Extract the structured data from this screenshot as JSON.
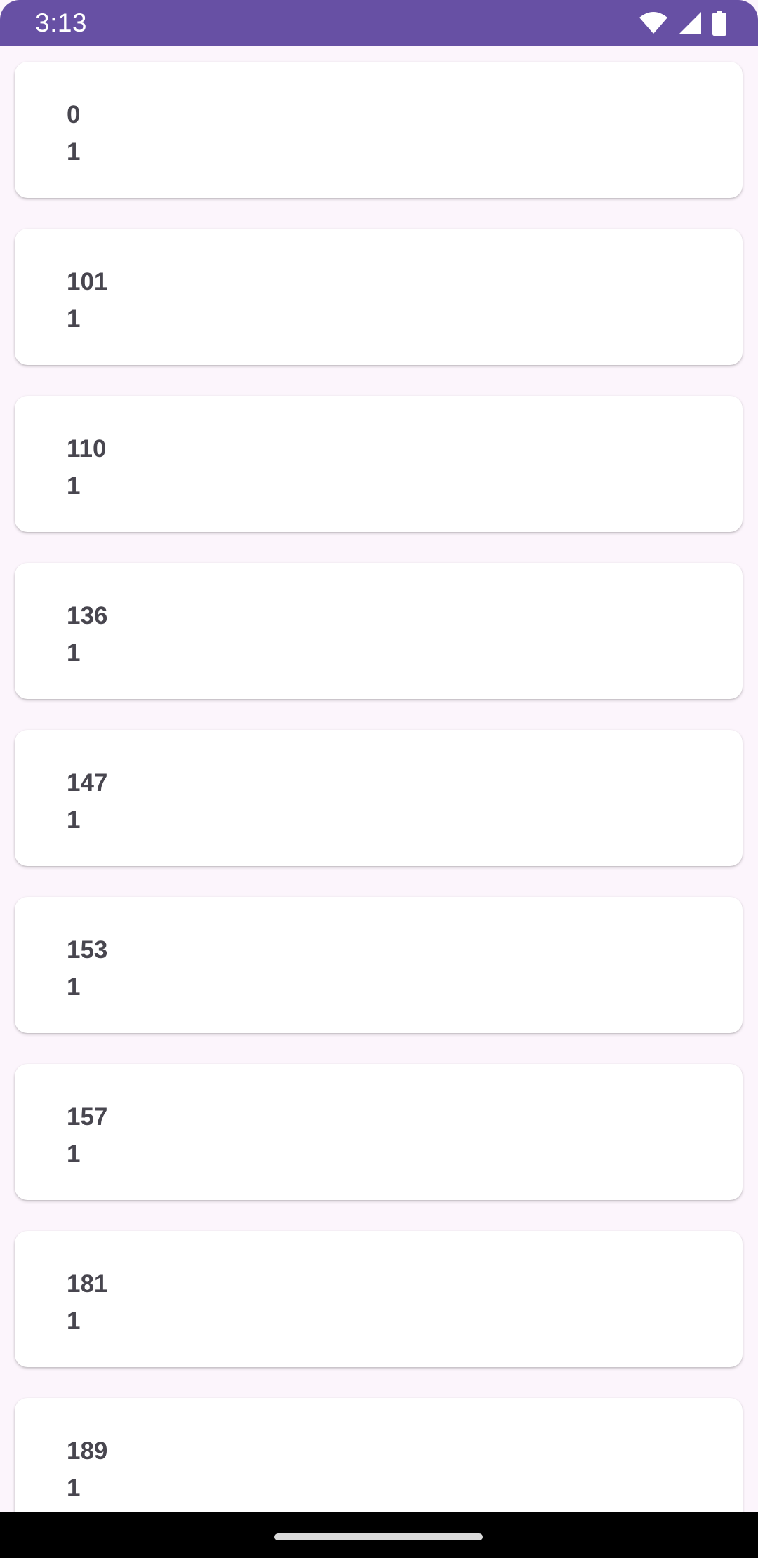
{
  "status_bar": {
    "time": "3:13",
    "background": "#6750A4",
    "icons": [
      "wifi-icon",
      "cellular-signal-icon",
      "battery-icon"
    ]
  },
  "list": {
    "items": [
      {
        "title": "0",
        "subtitle": "1"
      },
      {
        "title": "101",
        "subtitle": "1"
      },
      {
        "title": "110",
        "subtitle": "1"
      },
      {
        "title": "136",
        "subtitle": "1"
      },
      {
        "title": "147",
        "subtitle": "1"
      },
      {
        "title": "153",
        "subtitle": "1"
      },
      {
        "title": "157",
        "subtitle": "1"
      },
      {
        "title": "181",
        "subtitle": "1"
      },
      {
        "title": "189",
        "subtitle": "1"
      }
    ]
  },
  "colors": {
    "background": "#FCF5FC",
    "card": "#FFFFFF",
    "text": "#48464F"
  }
}
